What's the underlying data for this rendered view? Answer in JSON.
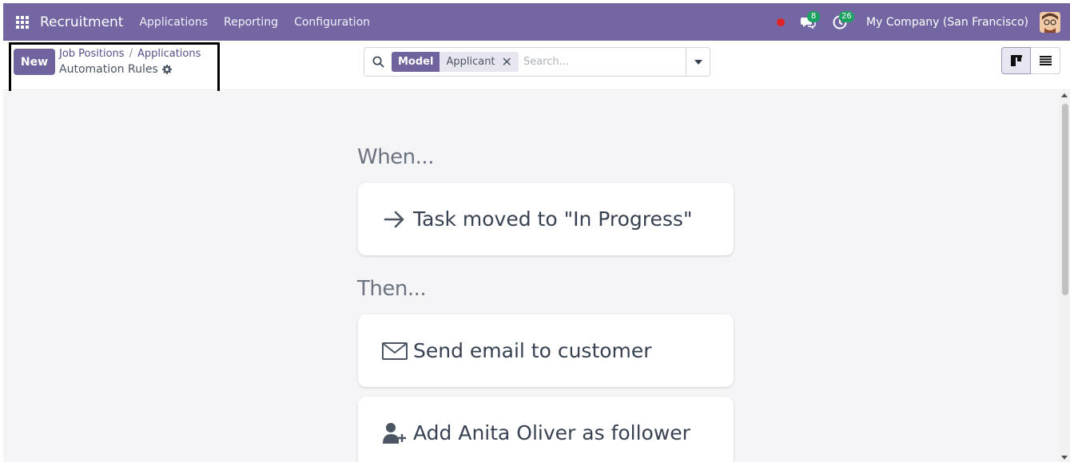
{
  "navbar": {
    "brand": "Recruitment",
    "menu": [
      "Applications",
      "Reporting",
      "Configuration"
    ],
    "messages_count": "8",
    "activities_count": "26",
    "company": "My Company (San Francisco)"
  },
  "control_panel": {
    "new_label": "New",
    "breadcrumbs": [
      "Job Positions",
      "Applications"
    ],
    "breadcrumb_separator": "/",
    "current": "Automation Rules"
  },
  "search": {
    "facet_label": "Model",
    "facet_value": "Applicant",
    "placeholder": "Search..."
  },
  "rule": {
    "when_heading": "When...",
    "trigger": "Task moved to \"In Progress\"",
    "then_heading": "Then...",
    "actions": [
      "Send email to customer",
      "Add Anita Oliver as follower"
    ]
  },
  "colors": {
    "brand": "#7466a2",
    "primary_button": "#71639e",
    "badge": "#1ba160",
    "recording_dot": "#e02424"
  },
  "icons": {
    "apps": "apps-grid-icon",
    "chat": "chat-icon",
    "activity": "clock-icon",
    "settings": "gear-icon",
    "search": "search-icon",
    "kanban_view": "kanban-icon",
    "list_view": "list-icon",
    "trigger": "arrow-right-icon",
    "email": "envelope-icon",
    "follower": "user-plus-icon"
  }
}
